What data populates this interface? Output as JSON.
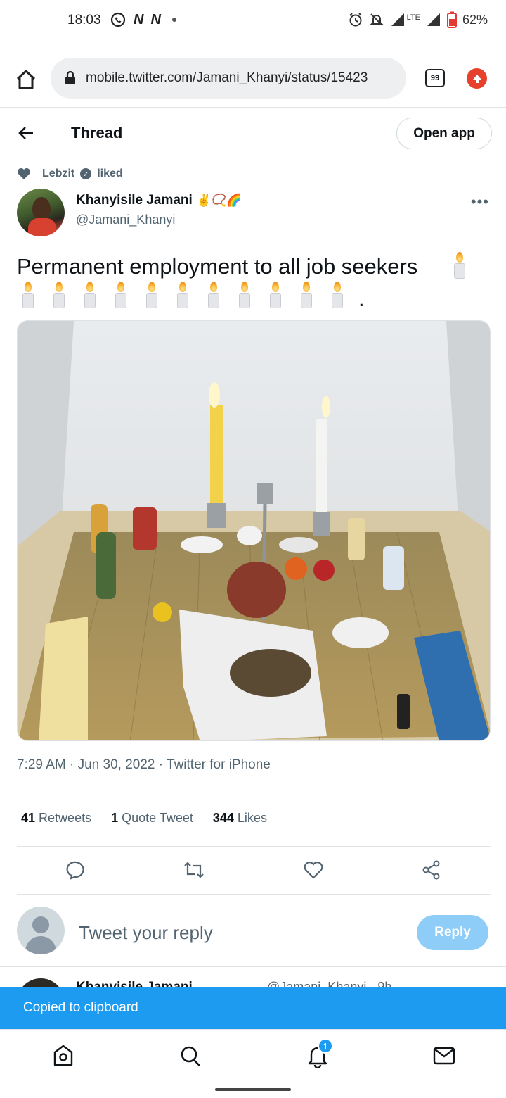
{
  "status_bar": {
    "time": "18:03",
    "network_label": "LTE",
    "battery": "62%",
    "icons": [
      "whatsapp-icon",
      "netflix-icon",
      "netflix-icon",
      "alarm-icon",
      "mute-icon",
      "signal-icon",
      "battery-icon"
    ]
  },
  "browser": {
    "url": "mobile.twitter.com/Jamani_Khanyi/status/15423",
    "tab_count": "99"
  },
  "header": {
    "title": "Thread",
    "open_app": "Open app"
  },
  "social_context": {
    "user": "Lebzit",
    "action": "liked"
  },
  "tweet": {
    "author_name": "Khanyisile Jamani",
    "author_emojis": "✌️📿🌈",
    "author_handle": "@Jamani_Khanyi",
    "text": "Permanent employment to all job seekers",
    "candle_count": 12,
    "trailing": ".",
    "timestamp": "7:29 AM · Jun 30, 2022 · Twitter for iPhone",
    "retweets_count": "41",
    "retweets_label": "Retweets",
    "quotes_count": "1",
    "quotes_label": "Quote Tweet",
    "likes_count": "344",
    "likes_label": "Likes"
  },
  "reply": {
    "placeholder": "Tweet your reply",
    "button": "Reply"
  },
  "next_tweet": {
    "author_name": "Khanyisile Jamani",
    "handle_time": "@Jamani_Khanyi · 9h"
  },
  "toast": "Copied to clipboard",
  "nav": {
    "notifications_badge": "1"
  },
  "colors": {
    "accent": "#1d9bf0",
    "reply_button": "#8ecdf8",
    "secondary_text": "#536471",
    "update_button": "#e5412d"
  }
}
